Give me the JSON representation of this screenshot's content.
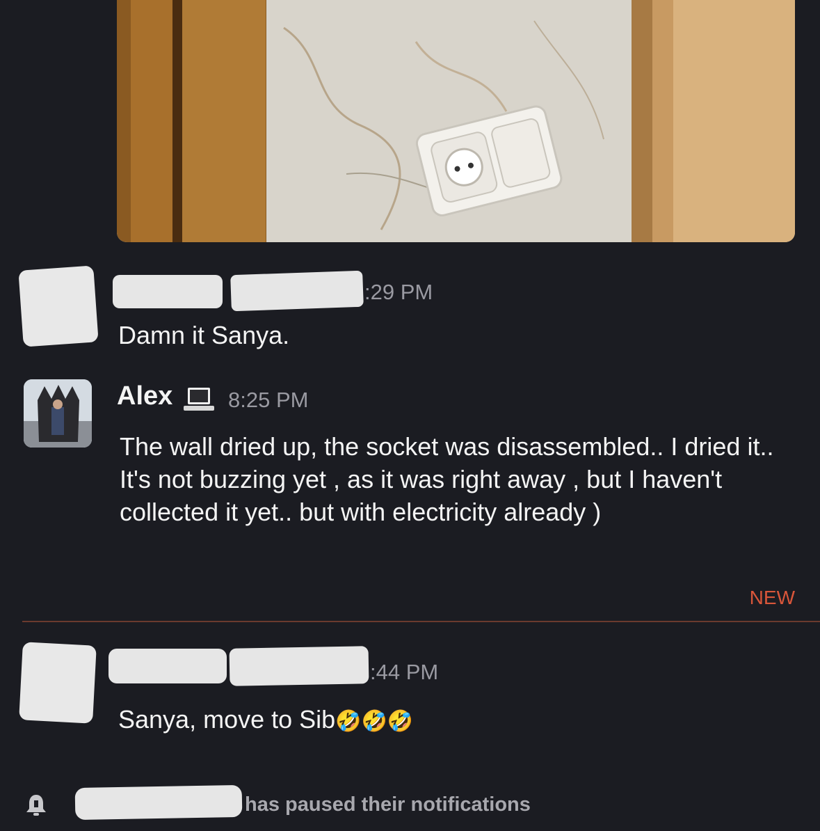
{
  "messages": [
    {
      "time": ":29 PM",
      "text": "Damn it Sanya."
    },
    {
      "username": "Alex",
      "time": "8:25 PM",
      "text": "The wall dried up, the socket was disassembled.. I dried it.. It's not buzzing yet , as it was right away , but I haven't collected it yet.. but with electricity already )"
    },
    {
      "time": ":44 PM",
      "text": "Sanya, move to Sib",
      "emoji": "🤣🤣🤣"
    }
  ],
  "divider": {
    "label": "NEW",
    "color": "#d9563a"
  },
  "system_notice": {
    "text": "has paused their notifications"
  },
  "colors": {
    "background": "#1b1c22",
    "timestamp": "#9a9aa2",
    "accent": "#d9563a"
  }
}
